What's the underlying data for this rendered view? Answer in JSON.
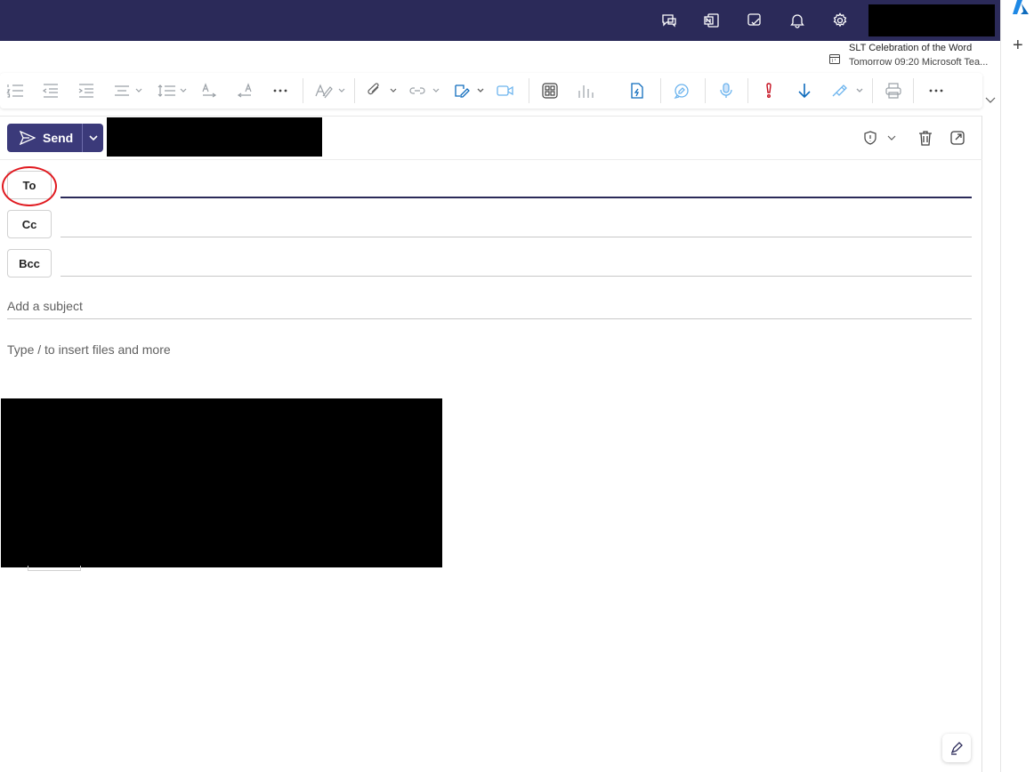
{
  "header": {
    "icons": [
      "feedback-icon",
      "onenote-icon",
      "my-day-icon",
      "bell-icon",
      "gear-icon"
    ]
  },
  "notification": {
    "title": "SLT Celebration of the Word",
    "detail": "Tomorrow 09:20 Microsoft Tea..."
  },
  "compose": {
    "send_label": "Send",
    "to_label": "To",
    "cc_label": "Cc",
    "bcc_label": "Bcc",
    "subject_placeholder": "Add a subject",
    "body_placeholder": "Type / to insert files and more"
  },
  "colors": {
    "header_bg": "#2b2a59",
    "send_bg": "#3b3a7a",
    "highlight": "#e0191f",
    "accent_blue": "#0f6cbd",
    "flag_red": "#c50f1f"
  }
}
